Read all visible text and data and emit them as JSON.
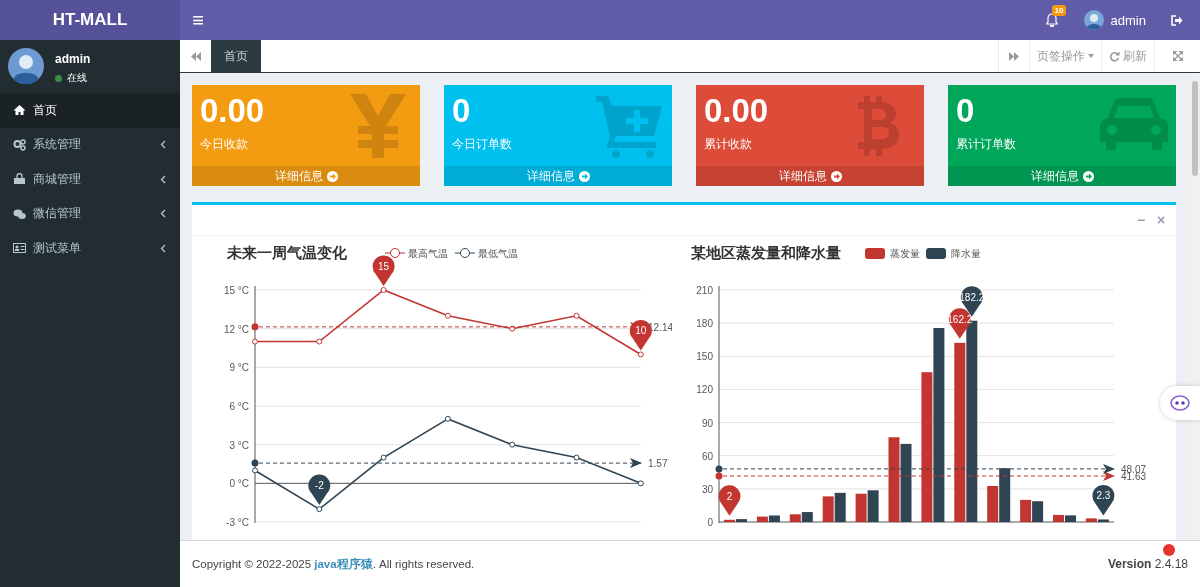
{
  "header": {
    "logo": "HT-MALL",
    "menu_glyph": "≡",
    "notification_count": "10",
    "user": "admin"
  },
  "sidebar": {
    "user": {
      "name": "admin",
      "status": "在线",
      "online": true
    },
    "items": [
      {
        "label": "首页",
        "selected": true,
        "has_submenu": false
      },
      {
        "label": "系统管理",
        "selected": false,
        "has_submenu": true
      },
      {
        "label": "商城管理",
        "selected": false,
        "has_submenu": true
      },
      {
        "label": "微信管理",
        "selected": false,
        "has_submenu": true
      },
      {
        "label": "测试菜单",
        "selected": false,
        "has_submenu": true
      }
    ]
  },
  "tabs": [
    {
      "label": "首页",
      "selected": true
    }
  ],
  "tab_actions": {
    "menu": "页签操作",
    "refresh": "刷新"
  },
  "info_boxes": [
    {
      "value": "0.00",
      "label": "今日收款",
      "link": "详细信息",
      "color": "#f39c12"
    },
    {
      "value": "0",
      "label": "今日订单数",
      "link": "详细信息",
      "color": "#00c0ef"
    },
    {
      "value": "0.00",
      "label": "累计收款",
      "link": "详细信息",
      "color": "#dd4b39"
    },
    {
      "value": "0",
      "label": "累计订单数",
      "link": "详细信息",
      "color": "#00a65a"
    }
  ],
  "box": {
    "tools": [
      "−",
      "×"
    ]
  },
  "temperature_chart": {
    "chart_data": {
      "type": "line",
      "title": "未来一周气温变化",
      "legend": true,
      "grid": true,
      "yticks": [
        {
          "value": -3,
          "label": "-3 °C"
        },
        {
          "value": 0,
          "label": "0 °C"
        },
        {
          "value": 3,
          "label": "3 °C"
        },
        {
          "value": 6,
          "label": "6 °C"
        },
        {
          "value": 9,
          "label": "9 °C"
        },
        {
          "value": 12,
          "label": "12 °C"
        },
        {
          "value": 15,
          "label": "15 °C"
        }
      ],
      "ylim": [
        -3,
        15
      ],
      "series": [
        {
          "name": "最高气温",
          "color": "#c23531",
          "marker": "circle",
          "values": [
            11,
            11,
            15,
            13,
            12,
            13,
            10
          ]
        },
        {
          "name": "最低气温",
          "color": "#2f4554",
          "marker": "circle",
          "values": [
            1,
            -2,
            2,
            5,
            3,
            2,
            0
          ]
        }
      ],
      "ref_lines": [
        {
          "axis": "y",
          "value": 12.14,
          "label": "12.14",
          "color": "#c23531"
        },
        {
          "axis": "y",
          "value": 1.57,
          "label": "1.57",
          "color": "#2f4554"
        }
      ],
      "annotations": [
        {
          "text": "15",
          "y": 15
        },
        {
          "text": "10",
          "y": 10
        },
        {
          "text": "-2",
          "y": -2
        }
      ]
    }
  },
  "rain_chart": {
    "chart_data": {
      "type": "bar",
      "title": "某地区蒸发量和降水量",
      "legend": true,
      "grid": true,
      "yticks": [
        0,
        30,
        60,
        90,
        120,
        150,
        180,
        210
      ],
      "ylim": [
        0,
        210
      ],
      "series": [
        {
          "name": "蒸发量",
          "color": "#c23531",
          "values": [
            2.0,
            4.9,
            7.0,
            23.2,
            25.6,
            76.7,
            135.6,
            162.2,
            32.6,
            20.0,
            6.4,
            3.3
          ]
        },
        {
          "name": "降水量",
          "color": "#2f4554",
          "values": [
            2.6,
            5.9,
            9.0,
            26.4,
            28.7,
            70.7,
            175.6,
            182.2,
            48.7,
            18.8,
            6.0,
            2.3
          ]
        }
      ],
      "ref_lines": [
        {
          "axis": "y",
          "value": 41.63,
          "label": "41.63",
          "color": "#c23531"
        },
        {
          "axis": "y",
          "value": 48.07,
          "label": "48.07",
          "color": "#2f4554"
        }
      ],
      "annotations": [
        {
          "text": "2",
          "y": 2
        },
        {
          "text": "162.2",
          "y": 162.2
        },
        {
          "text": "182.2",
          "y": 182.2
        },
        {
          "text": "2.3",
          "y": 2.3
        }
      ]
    }
  },
  "footer": {
    "copyright_prefix": "Copyright © 2022-2025 ",
    "link": "java程序猿",
    "copyright_suffix": ". All rights reserved.",
    "version_label": "Version",
    "version": "2.4.18"
  }
}
